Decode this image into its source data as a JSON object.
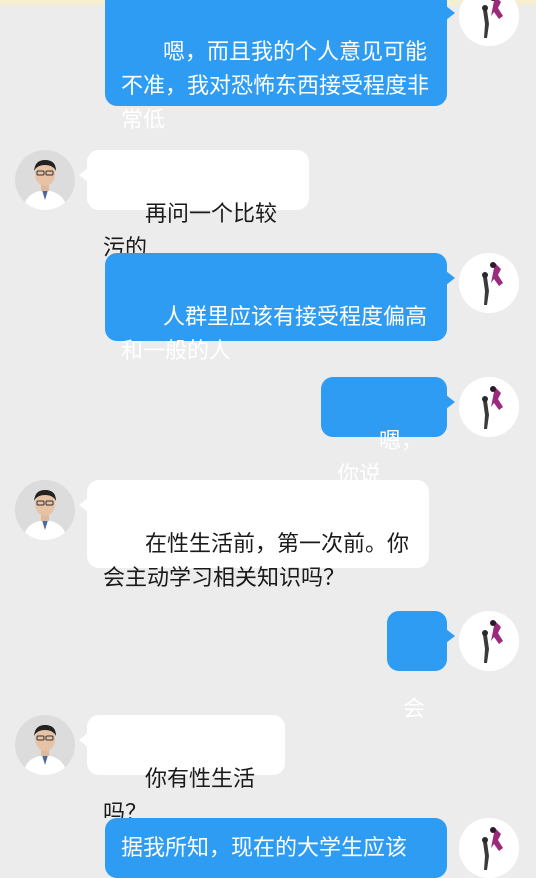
{
  "chat": {
    "messages": [
      {
        "direction": "out",
        "sender": "user",
        "text": "嗯，而且我的个人意见可能不准，我对恐怖东西接受程度非常低"
      },
      {
        "direction": "in",
        "sender": "doctor",
        "text": "再问一个比较污的"
      },
      {
        "direction": "out",
        "sender": "user",
        "text": "人群里应该有接受程度偏高和一般的人"
      },
      {
        "direction": "out",
        "sender": "user",
        "text": "嗯，你说"
      },
      {
        "direction": "in",
        "sender": "doctor",
        "text": "在性生活前，第一次前。你会主动学习相关知识吗？"
      },
      {
        "direction": "out",
        "sender": "user",
        "text": "会"
      },
      {
        "direction": "in",
        "sender": "doctor",
        "text": "你有性生活吗？"
      },
      {
        "direction": "out",
        "sender": "user",
        "text": "据我所知，现在的大学生应该"
      }
    ]
  },
  "colors": {
    "background": "#ececec",
    "outgoing_bubble": "#2f9cf4",
    "incoming_bubble": "#ffffff",
    "top_strip": "#f6efcf"
  },
  "icons": {
    "doctor_avatar": "doctor-avatar-icon",
    "user_avatar": "user-avatar-icon"
  }
}
